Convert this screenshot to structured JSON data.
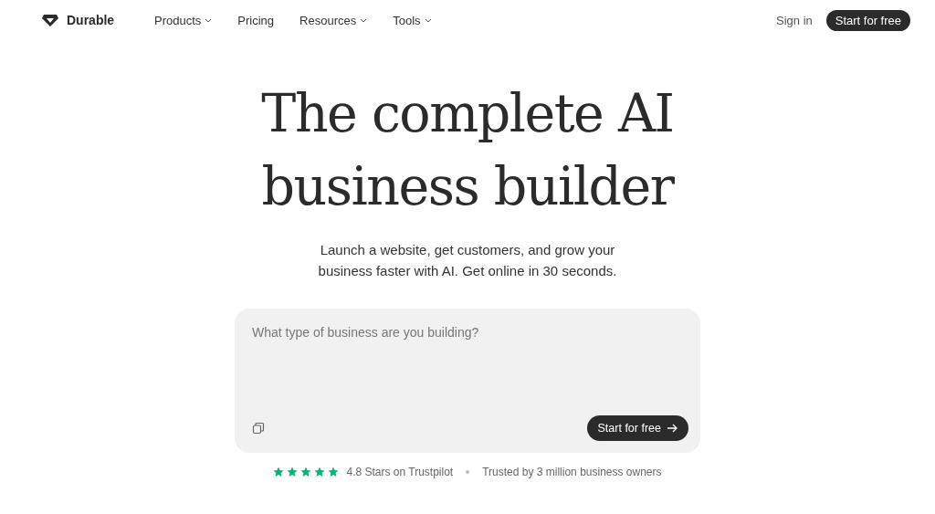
{
  "brand": {
    "name": "Durable"
  },
  "nav": [
    {
      "label": "Products",
      "dropdown": true
    },
    {
      "label": "Pricing",
      "dropdown": false
    },
    {
      "label": "Resources",
      "dropdown": true
    },
    {
      "label": "Tools",
      "dropdown": true
    }
  ],
  "header_actions": {
    "sign_in": "Sign in",
    "cta": "Start for free"
  },
  "hero": {
    "title_lines": [
      "The complete AI",
      "business builder"
    ],
    "subtitle_lines": [
      "Launch a website, get customers, and grow your",
      "business faster with AI. Get online in 30 seconds."
    ]
  },
  "prompt": {
    "placeholder": "What type of business are you building?",
    "submit": "Start for free"
  },
  "trust": {
    "stars": 5,
    "rating": "4.8 Stars on Trustpilot",
    "trusted": "Trusted by 3 million business owners"
  }
}
